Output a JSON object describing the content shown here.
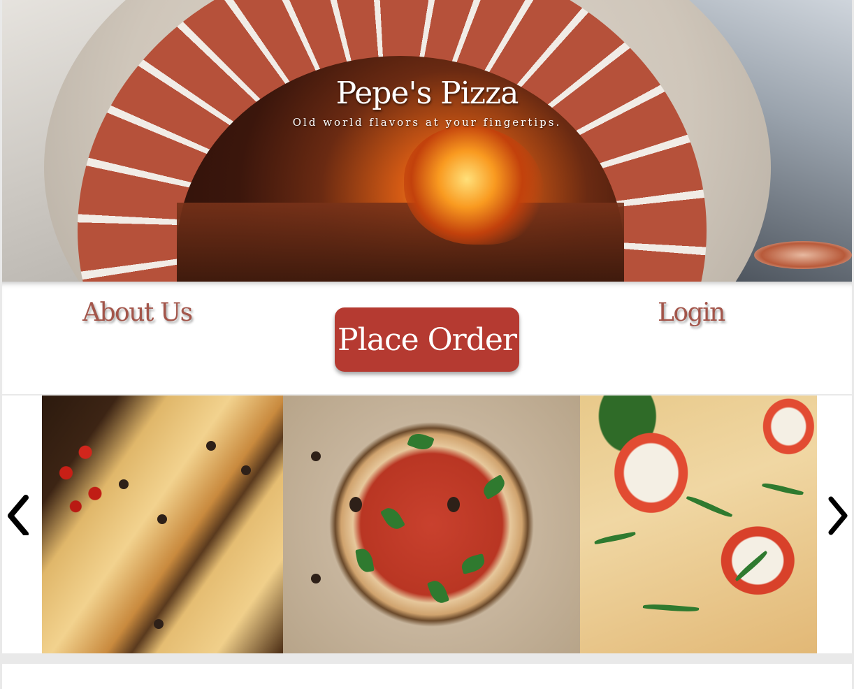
{
  "hero": {
    "title": "Pepe's Pizza",
    "tagline": "Old world flavors at your fingertips."
  },
  "nav": {
    "about_label": "About Us",
    "order_label": "Place Order",
    "login_label": "Login"
  },
  "carousel": {
    "prev_icon": "chevron-left-icon",
    "next_icon": "chevron-right-icon",
    "slide_count": 3
  },
  "colors": {
    "accent": "#b53a31",
    "nav_text": "#a3554a",
    "background": "#e9e9e9"
  }
}
